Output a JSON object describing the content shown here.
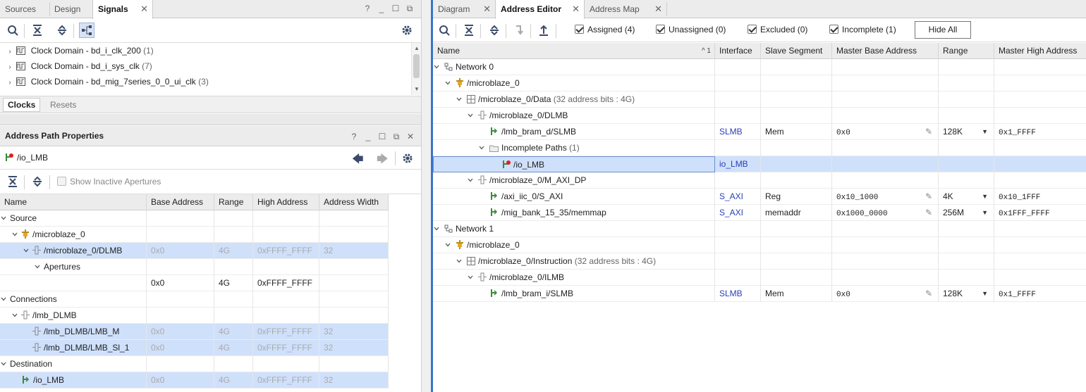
{
  "left_top": {
    "tabs": [
      "Sources",
      "Design",
      "Signals"
    ],
    "active_tab": "Signals",
    "window_buttons": [
      "?",
      "_",
      "☐",
      "⧉"
    ],
    "items": [
      {
        "label": "Clock Domain - bd_i_clk_200",
        "count": "(1)"
      },
      {
        "label": "Clock Domain - bd_i_sys_clk",
        "count": "(7)"
      },
      {
        "label": "Clock Domain - bd_mig_7series_0_0_ui_clk",
        "count": "(3)"
      }
    ],
    "bottom_tabs": [
      "Clocks",
      "Resets"
    ]
  },
  "path_props": {
    "title": "Address Path Properties",
    "window_buttons": [
      "?",
      "_",
      "☐",
      "⧉",
      "✕"
    ],
    "path": "/io_LMB",
    "show_inactive": "Show Inactive Apertures",
    "columns": [
      "Name",
      "Base Address",
      "Range",
      "High Address",
      "Address Width"
    ],
    "rows": [
      {
        "indent": 0,
        "chev": "v",
        "name": "Source"
      },
      {
        "indent": 1,
        "chev": "v",
        "icon": "cpu",
        "name": "/microblaze_0"
      },
      {
        "indent": 2,
        "chev": "v",
        "icon": "port",
        "name": "/microblaze_0/DLMB",
        "base": "0x0",
        "range": "4G",
        "high": "0xFFFF_FFFF",
        "width": "32",
        "sel": true,
        "gray": true
      },
      {
        "indent": 3,
        "chev": "v",
        "name": "Apertures"
      },
      {
        "indent": 4,
        "name": "",
        "base": "0x0",
        "range": "4G",
        "high": "0xFFFF_FFFF",
        "width": ""
      },
      {
        "indent": 0,
        "chev": "v",
        "name": "Connections"
      },
      {
        "indent": 1,
        "chev": "v",
        "icon": "port",
        "name": "/lmb_DLMB"
      },
      {
        "indent": 2,
        "icon": "port",
        "name": "/lmb_DLMB/LMB_M",
        "base": "0x0",
        "range": "4G",
        "high": "0xFFFF_FFFF",
        "width": "32",
        "sel": true,
        "gray": true
      },
      {
        "indent": 2,
        "icon": "port",
        "name": "/lmb_DLMB/LMB_Sl_1",
        "base": "0x0",
        "range": "4G",
        "high": "0xFFFF_FFFF",
        "width": "32",
        "sel": true,
        "gray": true
      },
      {
        "indent": 0,
        "chev": "v",
        "name": "Destination"
      },
      {
        "indent": 1,
        "icon": "slave",
        "name": "/io_LMB",
        "base": "0x0",
        "range": "4G",
        "high": "0xFFFF_FFFF",
        "width": "32",
        "sel": true,
        "gray": true
      }
    ]
  },
  "addr_editor": {
    "tabs": [
      "Diagram",
      "Address Editor",
      "Address Map"
    ],
    "active_tab": "Address Editor",
    "filters": [
      {
        "label": "Assigned (4)",
        "checked": true
      },
      {
        "label": "Unassigned (0)",
        "checked": true
      },
      {
        "label": "Excluded (0)",
        "checked": true
      },
      {
        "label": "Incomplete (1)",
        "checked": true
      }
    ],
    "hide_all": "Hide All",
    "sort_indicator": "^ 1",
    "columns": [
      "Name",
      "Interface",
      "Slave Segment",
      "Master Base Address",
      "Range",
      "Master High Address"
    ],
    "rows": [
      {
        "indent": 0,
        "chev": "v",
        "icon": "net",
        "name": "Network 0"
      },
      {
        "indent": 1,
        "chev": "v",
        "icon": "cpu",
        "name": "/microblaze_0"
      },
      {
        "indent": 2,
        "chev": "v",
        "icon": "grid",
        "name": "/microblaze_0/Data",
        "note": "(32 address bits : 4G)"
      },
      {
        "indent": 3,
        "chev": "v",
        "icon": "port",
        "name": "/microblaze_0/DLMB"
      },
      {
        "indent": 4,
        "icon": "slave",
        "name": "/lmb_bram_d/SLMB",
        "iface": "SLMB",
        "seg": "Mem",
        "base": "0x0",
        "range": "128K",
        "high": "0x1_FFFF"
      },
      {
        "indent": 4,
        "chev": "v",
        "icon": "folder",
        "name": "Incomplete Paths",
        "note": "(1)"
      },
      {
        "indent": 5,
        "icon": "slave-red",
        "name": "/io_LMB",
        "iface": "io_LMB",
        "sel": true
      },
      {
        "indent": 3,
        "chev": "v",
        "icon": "port",
        "name": "/microblaze_0/M_AXI_DP"
      },
      {
        "indent": 4,
        "icon": "slave",
        "name": "/axi_iic_0/S_AXI",
        "iface": "S_AXI",
        "seg": "Reg",
        "base": "0x10_1000",
        "range": "4K",
        "high": "0x10_1FFF"
      },
      {
        "indent": 4,
        "icon": "slave",
        "name": "/mig_bank_15_35/memmap",
        "iface": "S_AXI",
        "seg": "memaddr",
        "base": "0x1000_0000",
        "range": "256M",
        "high": "0x1FFF_FFFF"
      },
      {
        "indent": 0,
        "chev": "v",
        "icon": "net",
        "name": "Network 1"
      },
      {
        "indent": 1,
        "chev": "v",
        "icon": "cpu",
        "name": "/microblaze_0"
      },
      {
        "indent": 2,
        "chev": "v",
        "icon": "grid",
        "name": "/microblaze_0/Instruction",
        "note": "(32 address bits : 4G)"
      },
      {
        "indent": 3,
        "chev": "v",
        "icon": "port",
        "name": "/microblaze_0/ILMB"
      },
      {
        "indent": 4,
        "icon": "slave",
        "name": "/lmb_bram_i/SLMB",
        "iface": "SLMB",
        "seg": "Mem",
        "base": "0x0",
        "range": "128K",
        "high": "0x1_FFFF"
      }
    ]
  }
}
